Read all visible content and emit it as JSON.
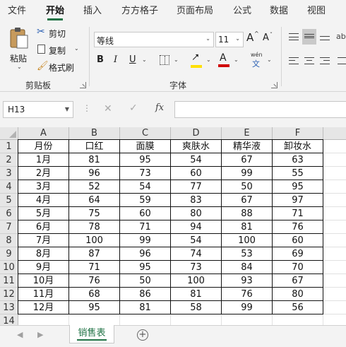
{
  "tabs": [
    "文件",
    "开始",
    "插入",
    "方方格子",
    "页面布局",
    "公式",
    "数据",
    "视图"
  ],
  "active_tab": "开始",
  "accent": "#217346",
  "clipboard": {
    "paste": "粘贴",
    "cut": "剪切",
    "copy": "复制",
    "format_painter": "格式刷",
    "group_label": "剪贴板"
  },
  "font": {
    "name": "等线",
    "size": "11",
    "grow": "A",
    "shrink": "A",
    "bold": "B",
    "italic": "I",
    "underline": "U",
    "font_color_glyph": "A",
    "phonetic_top": "wén",
    "phonetic_bottom": "文",
    "group_label": "字体",
    "highlight_color": "#ffe000",
    "font_color": "#d00000"
  },
  "formula_bar": {
    "name_box": "H13",
    "fx": "fx",
    "formula": ""
  },
  "sheet": {
    "columns": [
      "A",
      "B",
      "C",
      "D",
      "E",
      "F"
    ],
    "rows": [
      [
        "月份",
        "口红",
        "面膜",
        "爽肤水",
        "精华液",
        "卸妆水"
      ],
      [
        "1月",
        "81",
        "95",
        "54",
        "67",
        "63"
      ],
      [
        "2月",
        "96",
        "73",
        "60",
        "99",
        "55"
      ],
      [
        "3月",
        "52",
        "54",
        "77",
        "50",
        "95"
      ],
      [
        "4月",
        "64",
        "59",
        "83",
        "67",
        "97"
      ],
      [
        "5月",
        "75",
        "60",
        "80",
        "88",
        "71"
      ],
      [
        "6月",
        "78",
        "71",
        "94",
        "81",
        "76"
      ],
      [
        "7月",
        "100",
        "99",
        "54",
        "100",
        "60"
      ],
      [
        "8月",
        "87",
        "96",
        "74",
        "53",
        "69"
      ],
      [
        "9月",
        "71",
        "95",
        "73",
        "84",
        "70"
      ],
      [
        "10月",
        "76",
        "50",
        "100",
        "93",
        "67"
      ],
      [
        "11月",
        "68",
        "86",
        "81",
        "76",
        "80"
      ],
      [
        "12月",
        "95",
        "81",
        "58",
        "99",
        "56"
      ],
      [
        "",
        "",
        "",
        "",
        "",
        ""
      ]
    ],
    "row_numbers": [
      "1",
      "2",
      "3",
      "4",
      "5",
      "6",
      "7",
      "8",
      "9",
      "10",
      "11",
      "12",
      "13",
      "14"
    ]
  },
  "sheet_tabs": {
    "active": "销售表",
    "add": "+"
  }
}
